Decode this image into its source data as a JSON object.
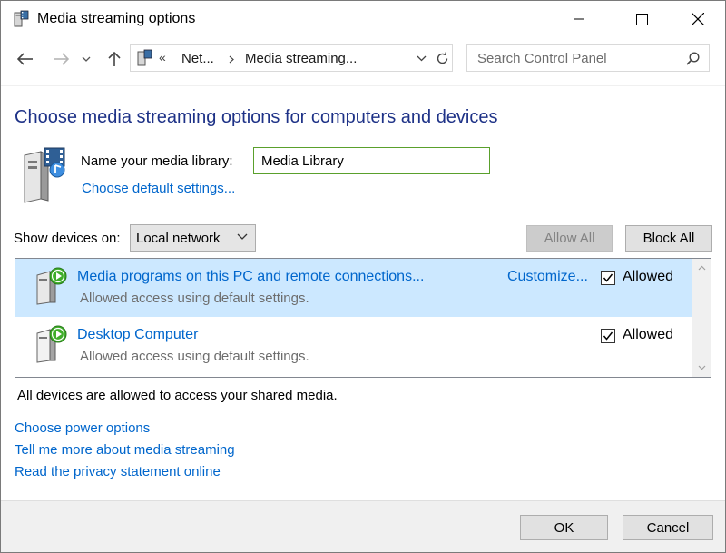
{
  "window": {
    "title": "Media streaming options"
  },
  "address": {
    "prefix": "«",
    "crumbs": [
      "Net...",
      "Media streaming..."
    ]
  },
  "search": {
    "placeholder": "Search Control Panel"
  },
  "main": {
    "heading": "Choose media streaming options for computers and devices",
    "library_label": "Name your media library:",
    "library_value": "Media Library",
    "default_settings_link": "Choose default settings...",
    "show_devices_label": "Show devices on:",
    "show_devices_value": "Local network",
    "allow_all_label": "Allow All",
    "block_all_label": "Block All",
    "devices": [
      {
        "name": "Media programs on this PC and remote connections...",
        "status": "Allowed access using default settings.",
        "customize": "Customize...",
        "allowed_label": "Allowed",
        "checked": true,
        "selected": true
      },
      {
        "name": "Desktop Computer",
        "status": "Allowed access using default settings.",
        "allowed_label": "Allowed",
        "checked": true,
        "selected": false
      }
    ],
    "summary": "All devices are allowed to access your shared media.",
    "links": [
      "Choose power options",
      "Tell me more about media streaming",
      "Read the privacy statement online"
    ]
  },
  "footer": {
    "ok_label": "OK",
    "cancel_label": "Cancel"
  },
  "colors": {
    "heading": "#1e3287",
    "link": "#0066cc",
    "selection": "#cce8ff",
    "field_border": "#5aa02c"
  }
}
